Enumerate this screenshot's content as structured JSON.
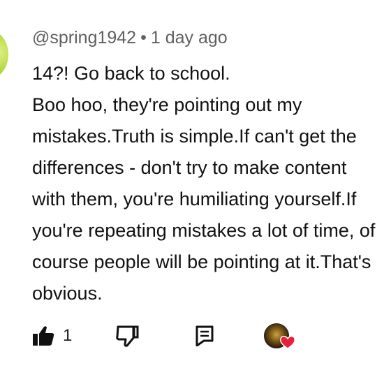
{
  "comment": {
    "author": "@spring1942",
    "separator": "•",
    "time": "1 day ago",
    "lines": [
      "14?! Go back to school.",
      "Boo hoo, they're pointing out my",
      "mistakes.Truth is simple.If can't get the",
      "differences - don't try to make content",
      "with them, you're humiliating yourself.If",
      "you're repeating mistakes a lot of time, of",
      "course people will be pointing at it.That's",
      "obvious."
    ]
  },
  "actions": {
    "like_count": "1",
    "icons": {
      "like": "thumbs-up-icon",
      "dislike": "thumbs-down-icon",
      "reply": "reply-icon",
      "hearted": "creator-heart-icon"
    },
    "colors": {
      "heart": "#e8203a",
      "icon": "#111111"
    }
  }
}
